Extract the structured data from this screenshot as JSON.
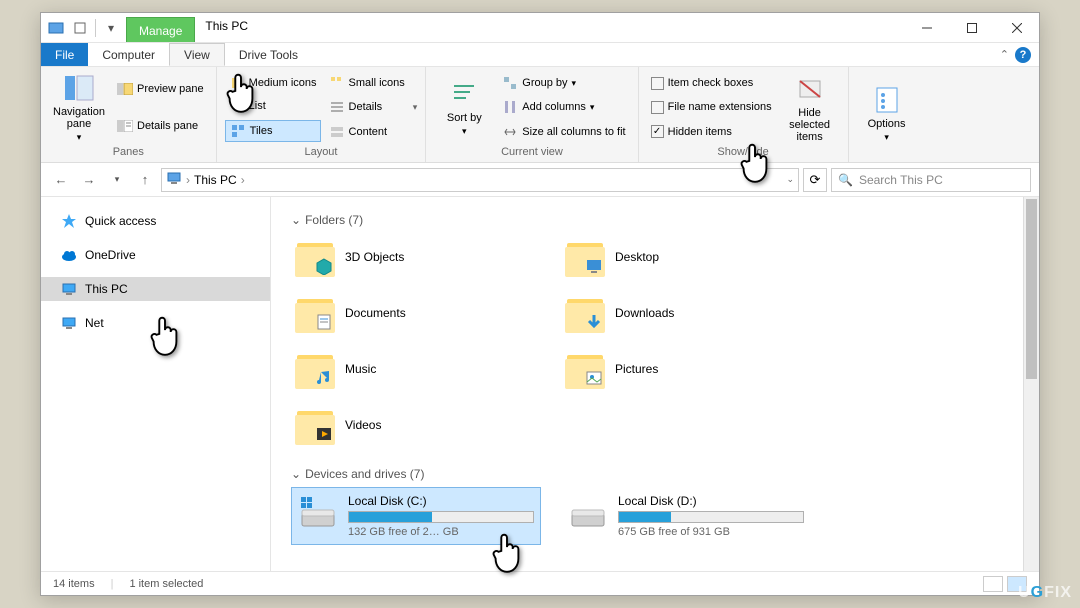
{
  "title": "This PC",
  "titletabs": {
    "manage": "Manage"
  },
  "menu": {
    "file": "File",
    "computer": "Computer",
    "view": "View",
    "drivetools": "Drive Tools"
  },
  "ribbon": {
    "panes": {
      "label": "Panes",
      "nav": "Navigation pane",
      "preview": "Preview pane",
      "details": "Details pane"
    },
    "layout": {
      "label": "Layout",
      "medium": "Medium icons",
      "small": "Small icons",
      "list": "List",
      "details": "Details",
      "tiles": "Tiles",
      "content": "Content"
    },
    "currentview": {
      "label": "Current view",
      "sortby": "Sort by",
      "groupby": "Group by",
      "addcols": "Add columns",
      "sizecols": "Size all columns to fit"
    },
    "showhide": {
      "label": "Show/hide",
      "itemcheck": "Item check boxes",
      "fileext": "File name extensions",
      "hidden": "Hidden items",
      "hidesel": "Hide selected items"
    },
    "options": "Options"
  },
  "address": {
    "root": "This PC"
  },
  "search": {
    "placeholder": "Search This PC"
  },
  "sidebar": {
    "items": [
      {
        "label": "Quick access",
        "icon": "star",
        "color": "#3fa9f5"
      },
      {
        "label": "OneDrive",
        "icon": "cloud",
        "color": "#0078d4"
      },
      {
        "label": "This PC",
        "icon": "monitor",
        "color": "#3fa9f5",
        "selected": true
      },
      {
        "label": "Net",
        "icon": "monitor",
        "color": "#3fa9f5"
      }
    ]
  },
  "content": {
    "folders_hdr": "Folders (7)",
    "folders": [
      {
        "label": "3D Objects"
      },
      {
        "label": "Desktop"
      },
      {
        "label": "Documents"
      },
      {
        "label": "Downloads"
      },
      {
        "label": "Music"
      },
      {
        "label": "Pictures"
      },
      {
        "label": "Videos"
      }
    ],
    "drives_hdr": "Devices and drives (7)",
    "drives": [
      {
        "label": "Local Disk (C:)",
        "free": "132 GB free of 2… GB",
        "fill": 45,
        "selected": true,
        "os": true
      },
      {
        "label": "Local Disk (D:)",
        "free": "675 GB free of 931 GB",
        "fill": 28,
        "selected": false,
        "os": false
      }
    ]
  },
  "status": {
    "count": "14 items",
    "sel": "1 item selected"
  },
  "watermark": {
    "a": "U",
    "b": "FIX"
  }
}
